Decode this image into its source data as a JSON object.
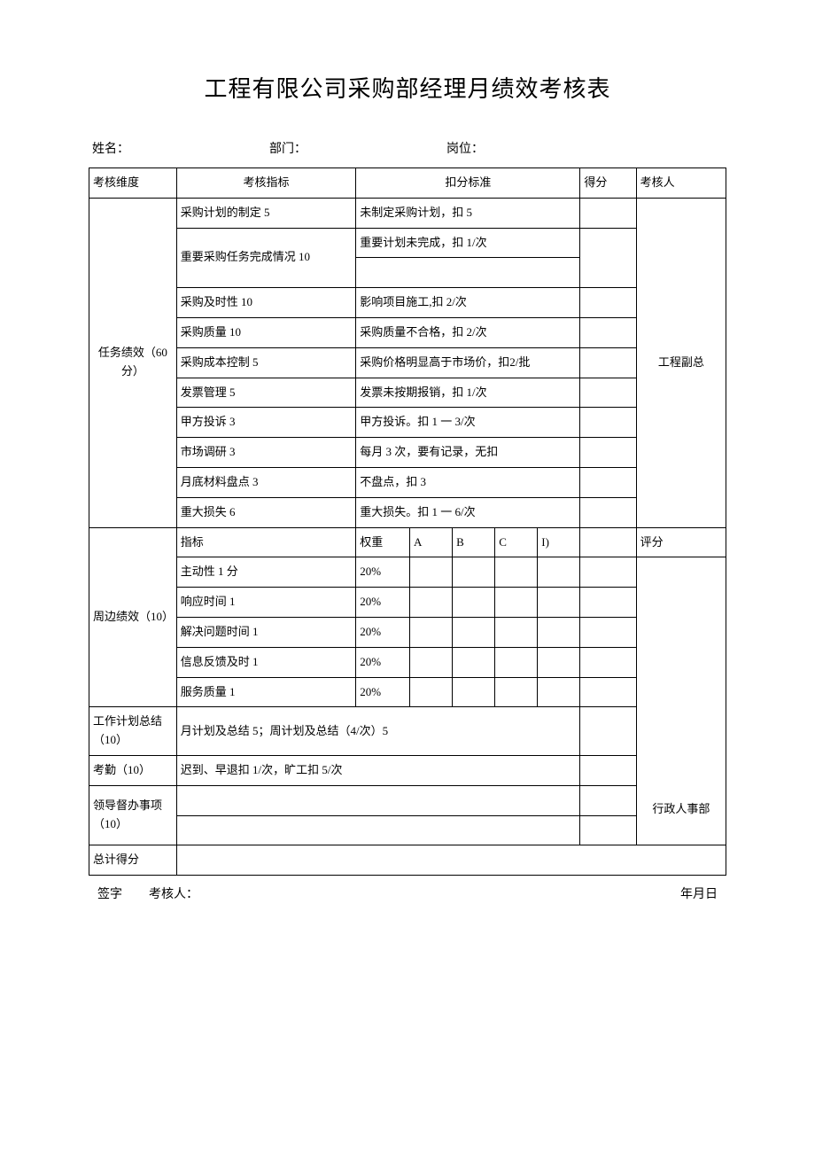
{
  "title": "工程有限公司采购部经理月绩效考核表",
  "header": {
    "name_label": "姓名：",
    "dept_label": "部门：",
    "post_label": "岗位："
  },
  "columns": {
    "dimension": "考核维度",
    "metric": "考核指标",
    "standard": "扣分标准",
    "score": "得分",
    "reviewer": "考核人"
  },
  "task": {
    "dimension": "任务绩效（60分）",
    "reviewer": "工程副总",
    "rows": [
      {
        "metric": "采购计划的制定 5",
        "standard": "未制定采购计划，扣 5"
      },
      {
        "metric": "重要采购任务完成情况 10",
        "standard": "重要计划未完成，扣 1/次"
      },
      {
        "metric": "采购及时性 10",
        "standard": "影响项目施工,扣 2/次"
      },
      {
        "metric": "采购质量 10",
        "standard": "采购质量不合格，扣 2/次"
      },
      {
        "metric": "采购成本控制 5",
        "standard": "采购价格明显高于市场价，扣2/批"
      },
      {
        "metric": "发票管理 5",
        "standard": "发票未按期报销，扣 1/次"
      },
      {
        "metric": "甲方投诉 3",
        "standard": "甲方投诉。扣 1 一 3/次"
      },
      {
        "metric": "市场调研 3",
        "standard": "每月 3 次，要有记录，无扣"
      },
      {
        "metric": "月底材料盘点 3",
        "standard": "不盘点，扣 3"
      },
      {
        "metric": "重大损失 6",
        "standard": "重大损失。扣 1 一 6/次"
      }
    ]
  },
  "peripheral": {
    "dimension": "周边绩效（10）",
    "header": {
      "metric": "指标",
      "weight": "权重",
      "a": "A",
      "b": "B",
      "c": "C",
      "d": "I)",
      "reviewer": "评分"
    },
    "rows": [
      {
        "metric": "主动性 1 分",
        "weight": "20%"
      },
      {
        "metric": "响应时间 1",
        "weight": "20%"
      },
      {
        "metric": "解决问题时间 1",
        "weight": "20%"
      },
      {
        "metric": "信息反馈及时 1",
        "weight": "20%"
      },
      {
        "metric": "服务质量 1",
        "weight": "20%"
      }
    ],
    "reviewer": "行政人事部"
  },
  "plan": {
    "dimension": "工作计划总结（10）",
    "content": "月计划及总结 5；周计划及总结（4/次）5"
  },
  "attendance": {
    "dimension": "考勤（10）",
    "content": "迟到、早退扣 1/次，旷工扣 5/次"
  },
  "supervise": {
    "dimension": "领导督办事项（10）"
  },
  "total": {
    "dimension": "总计得分"
  },
  "footer": {
    "sign": "签字",
    "reviewer": "考核人：",
    "date": "年月日"
  }
}
